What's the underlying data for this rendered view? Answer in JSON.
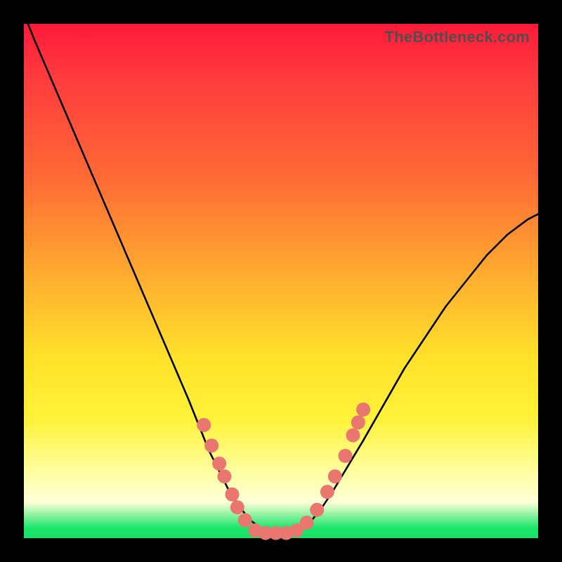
{
  "watermark": "TheBottleneck.com",
  "colors": {
    "frame": "#000000",
    "curve": "#000000",
    "marker_fill": "#e9766f",
    "gradient_stops": [
      "#ff1a3a",
      "#ff3a3e",
      "#ff6a35",
      "#ffb030",
      "#ffe22a",
      "#fff23a",
      "#ffffa0",
      "#ffffd8",
      "#1be66a",
      "#19e168"
    ]
  },
  "chart_data": {
    "type": "line",
    "title": "",
    "xlabel": "",
    "ylabel": "",
    "xlim": [
      0,
      100
    ],
    "ylim": [
      0,
      100
    ],
    "grid": false,
    "legend": false,
    "annotations": [
      "TheBottleneck.com"
    ],
    "series": [
      {
        "name": "bottleneck-curve",
        "x": [
          0,
          2,
          5,
          8,
          11,
          14,
          17,
          20,
          23,
          26,
          29,
          32,
          34,
          36,
          38,
          40,
          42,
          44,
          46,
          48,
          50,
          52,
          54,
          56,
          58,
          60,
          63,
          66,
          70,
          74,
          78,
          82,
          86,
          90,
          94,
          98,
          100
        ],
        "y": [
          102,
          97,
          90,
          83,
          76,
          69,
          62,
          55,
          48,
          41,
          34,
          27,
          22,
          17,
          13,
          9,
          6,
          3.5,
          2,
          1,
          1,
          1,
          2,
          3.5,
          6,
          9,
          14,
          19,
          26,
          33,
          39,
          45,
          50,
          55,
          59,
          62,
          63
        ]
      }
    ],
    "markers": [
      {
        "x": 35.0,
        "y": 22.0
      },
      {
        "x": 36.5,
        "y": 18.0
      },
      {
        "x": 38.0,
        "y": 14.5
      },
      {
        "x": 39.0,
        "y": 12.0
      },
      {
        "x": 40.5,
        "y": 8.5
      },
      {
        "x": 41.5,
        "y": 6.0
      },
      {
        "x": 43.0,
        "y": 3.5
      },
      {
        "x": 45.0,
        "y": 1.5
      },
      {
        "x": 47.0,
        "y": 1.0
      },
      {
        "x": 49.0,
        "y": 1.0
      },
      {
        "x": 51.0,
        "y": 1.0
      },
      {
        "x": 53.0,
        "y": 1.5
      },
      {
        "x": 55.0,
        "y": 3.0
      },
      {
        "x": 57.0,
        "y": 5.5
      },
      {
        "x": 59.0,
        "y": 9.0
      },
      {
        "x": 60.5,
        "y": 12.0
      },
      {
        "x": 62.5,
        "y": 16.0
      },
      {
        "x": 64.0,
        "y": 20.0
      },
      {
        "x": 65.0,
        "y": 22.5
      },
      {
        "x": 66.0,
        "y": 25.0
      }
    ]
  }
}
